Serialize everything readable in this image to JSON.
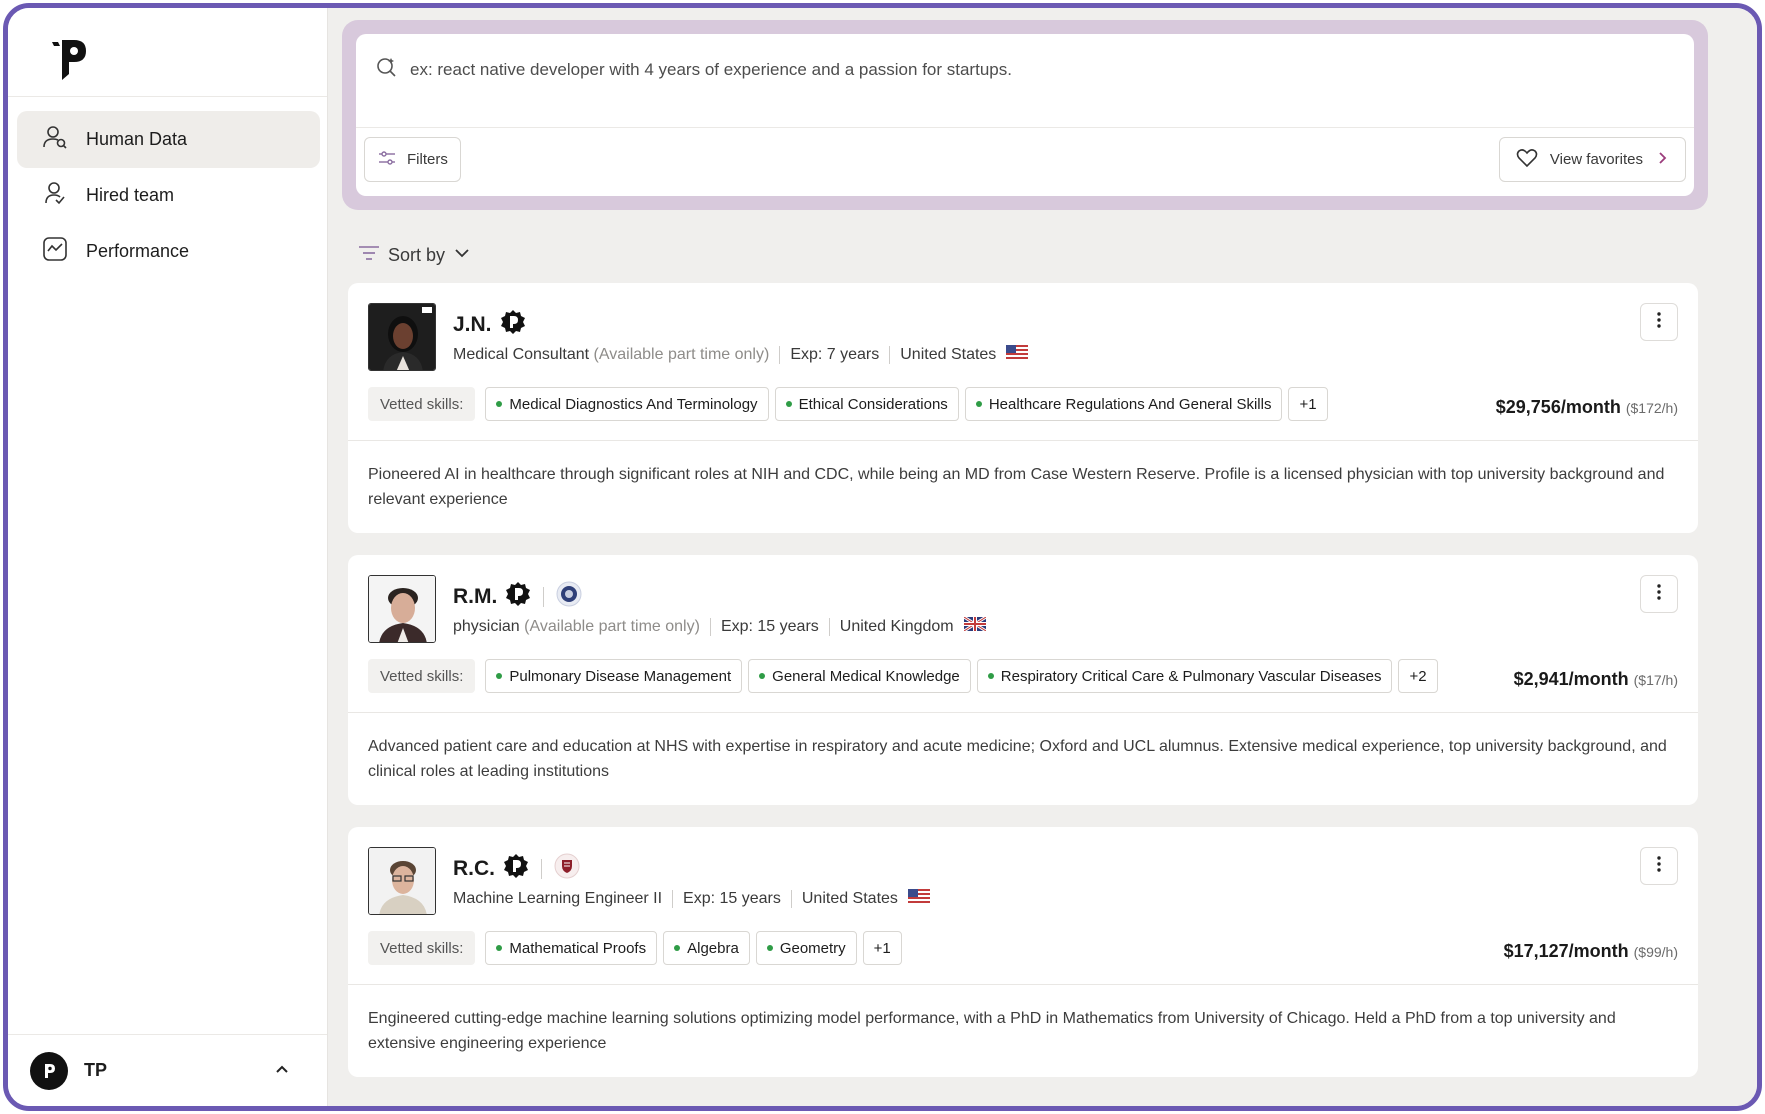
{
  "sidebar": {
    "items": [
      {
        "label": "Human Data"
      },
      {
        "label": "Hired team"
      },
      {
        "label": "Performance"
      }
    ],
    "user": {
      "name": "TP"
    }
  },
  "search": {
    "placeholder": "ex: react native developer with 4 years of experience and a passion for startups.",
    "filters_label": "Filters",
    "favorites_label": "View favorites"
  },
  "sort": {
    "label": "Sort by"
  },
  "candidates": [
    {
      "name": "J.N.",
      "role": "Medical Consultant",
      "availability": "(Available part time only)",
      "experience": "Exp: 7 years",
      "country": "United States",
      "vetted_label": "Vetted skills:",
      "skills": [
        "Medical Diagnostics And Terminology",
        "Ethical Considerations",
        "Healthcare Regulations And General Skills"
      ],
      "more_skills": "+1",
      "price_month": "$29,756/month",
      "price_hour": "($172/h)",
      "description": "Pioneered AI in healthcare through significant roles at NIH and CDC, while being an MD from Case Western Reserve. Profile is a licensed physician with top university background and relevant experience"
    },
    {
      "name": "R.M.",
      "role": "physician",
      "availability": "(Available part time only)",
      "experience": "Exp: 15 years",
      "country": "United Kingdom",
      "vetted_label": "Vetted skills:",
      "skills": [
        "Pulmonary Disease Management",
        "General Medical Knowledge",
        "Respiratory Critical Care & Pulmonary Vascular Diseases"
      ],
      "more_skills": "+2",
      "price_month": "$2,941/month",
      "price_hour": "($17/h)",
      "description": "Advanced patient care and education at NHS with expertise in respiratory and acute medicine; Oxford and UCL alumnus. Extensive medical experience, top university background, and clinical roles at leading institutions"
    },
    {
      "name": "R.C.",
      "role": "Machine Learning Engineer II",
      "experience": "Exp: 15 years",
      "country": "United States",
      "vetted_label": "Vetted skills:",
      "skills": [
        "Mathematical Proofs",
        "Algebra",
        "Geometry"
      ],
      "more_skills": "+1",
      "price_month": "$17,127/month",
      "price_hour": "($99/h)",
      "description": "Engineered cutting-edge machine learning solutions optimizing model performance, with a PhD in Mathematics from University of Chicago. Held a PhD from a top university and extensive engineering experience"
    }
  ],
  "colors": {
    "frame_border": "#6b59b3",
    "search_panel": "#d8c9dc",
    "main_background": "#f0efed",
    "skill_dot": "#2f9c46"
  },
  "icons": [
    "app-logo-icon",
    "person-search-icon",
    "person-check-icon",
    "chart-icon",
    "sparkle-search-icon",
    "sliders-icon",
    "heart-icon",
    "chevron-right-icon",
    "filter-lines-icon",
    "chevron-down-icon",
    "verified-badge-icon",
    "university-seal-icon",
    "kebab-menu-icon",
    "us-flag-icon",
    "uk-flag-icon",
    "chevron-up-icon"
  ]
}
